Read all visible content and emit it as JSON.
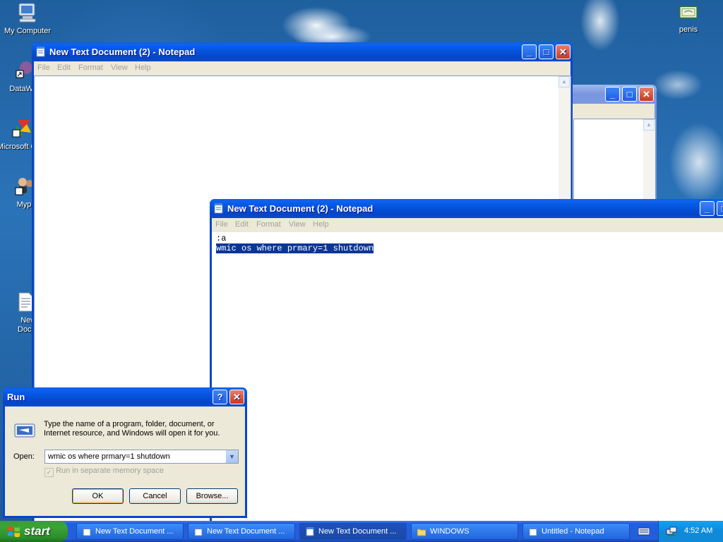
{
  "desktop_icons": [
    {
      "label": "My Computer",
      "icon": "my-computer-icon"
    },
    {
      "label": "DataWa",
      "icon": "shortcut-icon"
    },
    {
      "label": "Microsoft C++",
      "icon": "visual-cpp-icon"
    },
    {
      "label": "Myp",
      "icon": "people-icon"
    },
    {
      "label": "New T Docume",
      "icon": "text-document-icon"
    },
    {
      "label": "penis",
      "icon": "certificate-icon"
    }
  ],
  "notepad_back": {
    "title": "New Text Document (2) - Notepad",
    "menu": [
      "File",
      "Edit",
      "Format",
      "View",
      "Help"
    ]
  },
  "notepad_front": {
    "title": "New Text Document (2) - Notepad",
    "menu": [
      "File",
      "Edit",
      "Format",
      "View",
      "Help"
    ],
    "lines": [
      ":a",
      "wmic os where prmary=1 shutdown"
    ]
  },
  "run_dialog": {
    "title": "Run",
    "description": "Type the name of a program, folder, document, or Internet resource, and Windows will open it for you.",
    "open_label": "Open:",
    "open_value": "wmic os where prmary=1 shutdown",
    "checkbox_label": "Run in separate memory space",
    "ok": "OK",
    "cancel": "Cancel",
    "browse": "Browse..."
  },
  "taskbar": {
    "start": "start",
    "tasks": [
      {
        "label": "New Text Document ...",
        "icon": "notepad-icon"
      },
      {
        "label": "New Text Document ...",
        "icon": "notepad-icon"
      },
      {
        "label": "New Text Document ...",
        "icon": "notepad-icon"
      },
      {
        "label": "WINDOWS",
        "icon": "folder-icon"
      },
      {
        "label": "Untitled - Notepad",
        "icon": "notepad-icon"
      }
    ],
    "clock": "4:52 AM"
  },
  "colors": {
    "title_active": "#0a4ccd",
    "selection": "#0b3596",
    "taskbar": "#245edb",
    "start": "#3ba337"
  }
}
